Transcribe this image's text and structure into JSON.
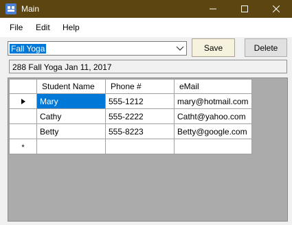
{
  "window": {
    "title": "Main",
    "accent": "#5c4510"
  },
  "menu": {
    "file": "File",
    "edit": "Edit",
    "help": "Help"
  },
  "combo": {
    "value": "Fall Yoga"
  },
  "buttons": {
    "save": "Save",
    "delete": "Delete"
  },
  "info": {
    "text": "288 Fall Yoga Jan 11, 2017"
  },
  "grid": {
    "columns": [
      "Student Name",
      "Phone #",
      "eMail"
    ],
    "rows": [
      {
        "name": "Mary",
        "phone": "555-1212",
        "email": "mary@hotmail.com",
        "current": true
      },
      {
        "name": "Cathy",
        "phone": "555-2222",
        "email": "Catht@yahoo.com"
      },
      {
        "name": "Betty",
        "phone": "555-8223",
        "email": "Betty@google.com"
      }
    ],
    "new_row_marker": "*"
  }
}
